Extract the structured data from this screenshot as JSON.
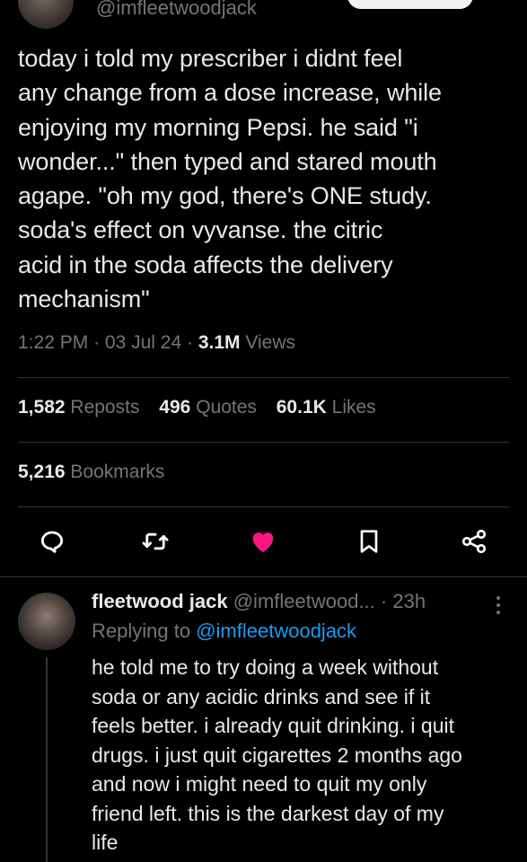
{
  "header": {
    "handle": "@imfleetwoodjack"
  },
  "tweet": {
    "text": "today i told my prescriber i didnt feel\nany change from a dose increase, while\nenjoying my morning Pepsi. he said \"i\nwonder...\" then typed and stared mouth\nagape. \"oh my god, there's ONE study.\nsoda's effect on vyvanse. the citric\nacid in the soda affects the delivery\nmechanism\"",
    "time": "1:22 PM",
    "date": "03 Jul 24",
    "views_count": "3.1M",
    "views_label": "Views",
    "separator": "·"
  },
  "stats": {
    "reposts_count": "1,582",
    "reposts_label": "Reposts",
    "quotes_count": "496",
    "quotes_label": "Quotes",
    "likes_count": "60.1K",
    "likes_label": "Likes",
    "bookmarks_count": "5,216",
    "bookmarks_label": "Bookmarks"
  },
  "actions": [
    {
      "name": "reply",
      "icon": "reply-icon"
    },
    {
      "name": "repost",
      "icon": "repost-icon"
    },
    {
      "name": "like",
      "icon": "heart-icon",
      "active": true,
      "color": "#f91880"
    },
    {
      "name": "bookmark",
      "icon": "bookmark-icon"
    },
    {
      "name": "share",
      "icon": "share-icon"
    }
  ],
  "reply": {
    "name": "fleetwood jack",
    "handle": "@imfleetwood...",
    "time": "· 23h",
    "replying_prefix": "Replying to",
    "replying_to": "@imfleetwoodjack",
    "text": "he told me to try doing a week without\nsoda or any acidic drinks and see if it\nfeels better. i already quit drinking. i quit\ndrugs. i just quit cigarettes 2 months ago\nand now i might need to quit my only\nfriend left. this is the darkest day of my\nlife"
  },
  "colors": {
    "background": "#000000",
    "text": "#e7e9ea",
    "muted": "#71767b",
    "accent": "#1d9bf0",
    "like": "#f91880",
    "divider": "#2f3336"
  }
}
